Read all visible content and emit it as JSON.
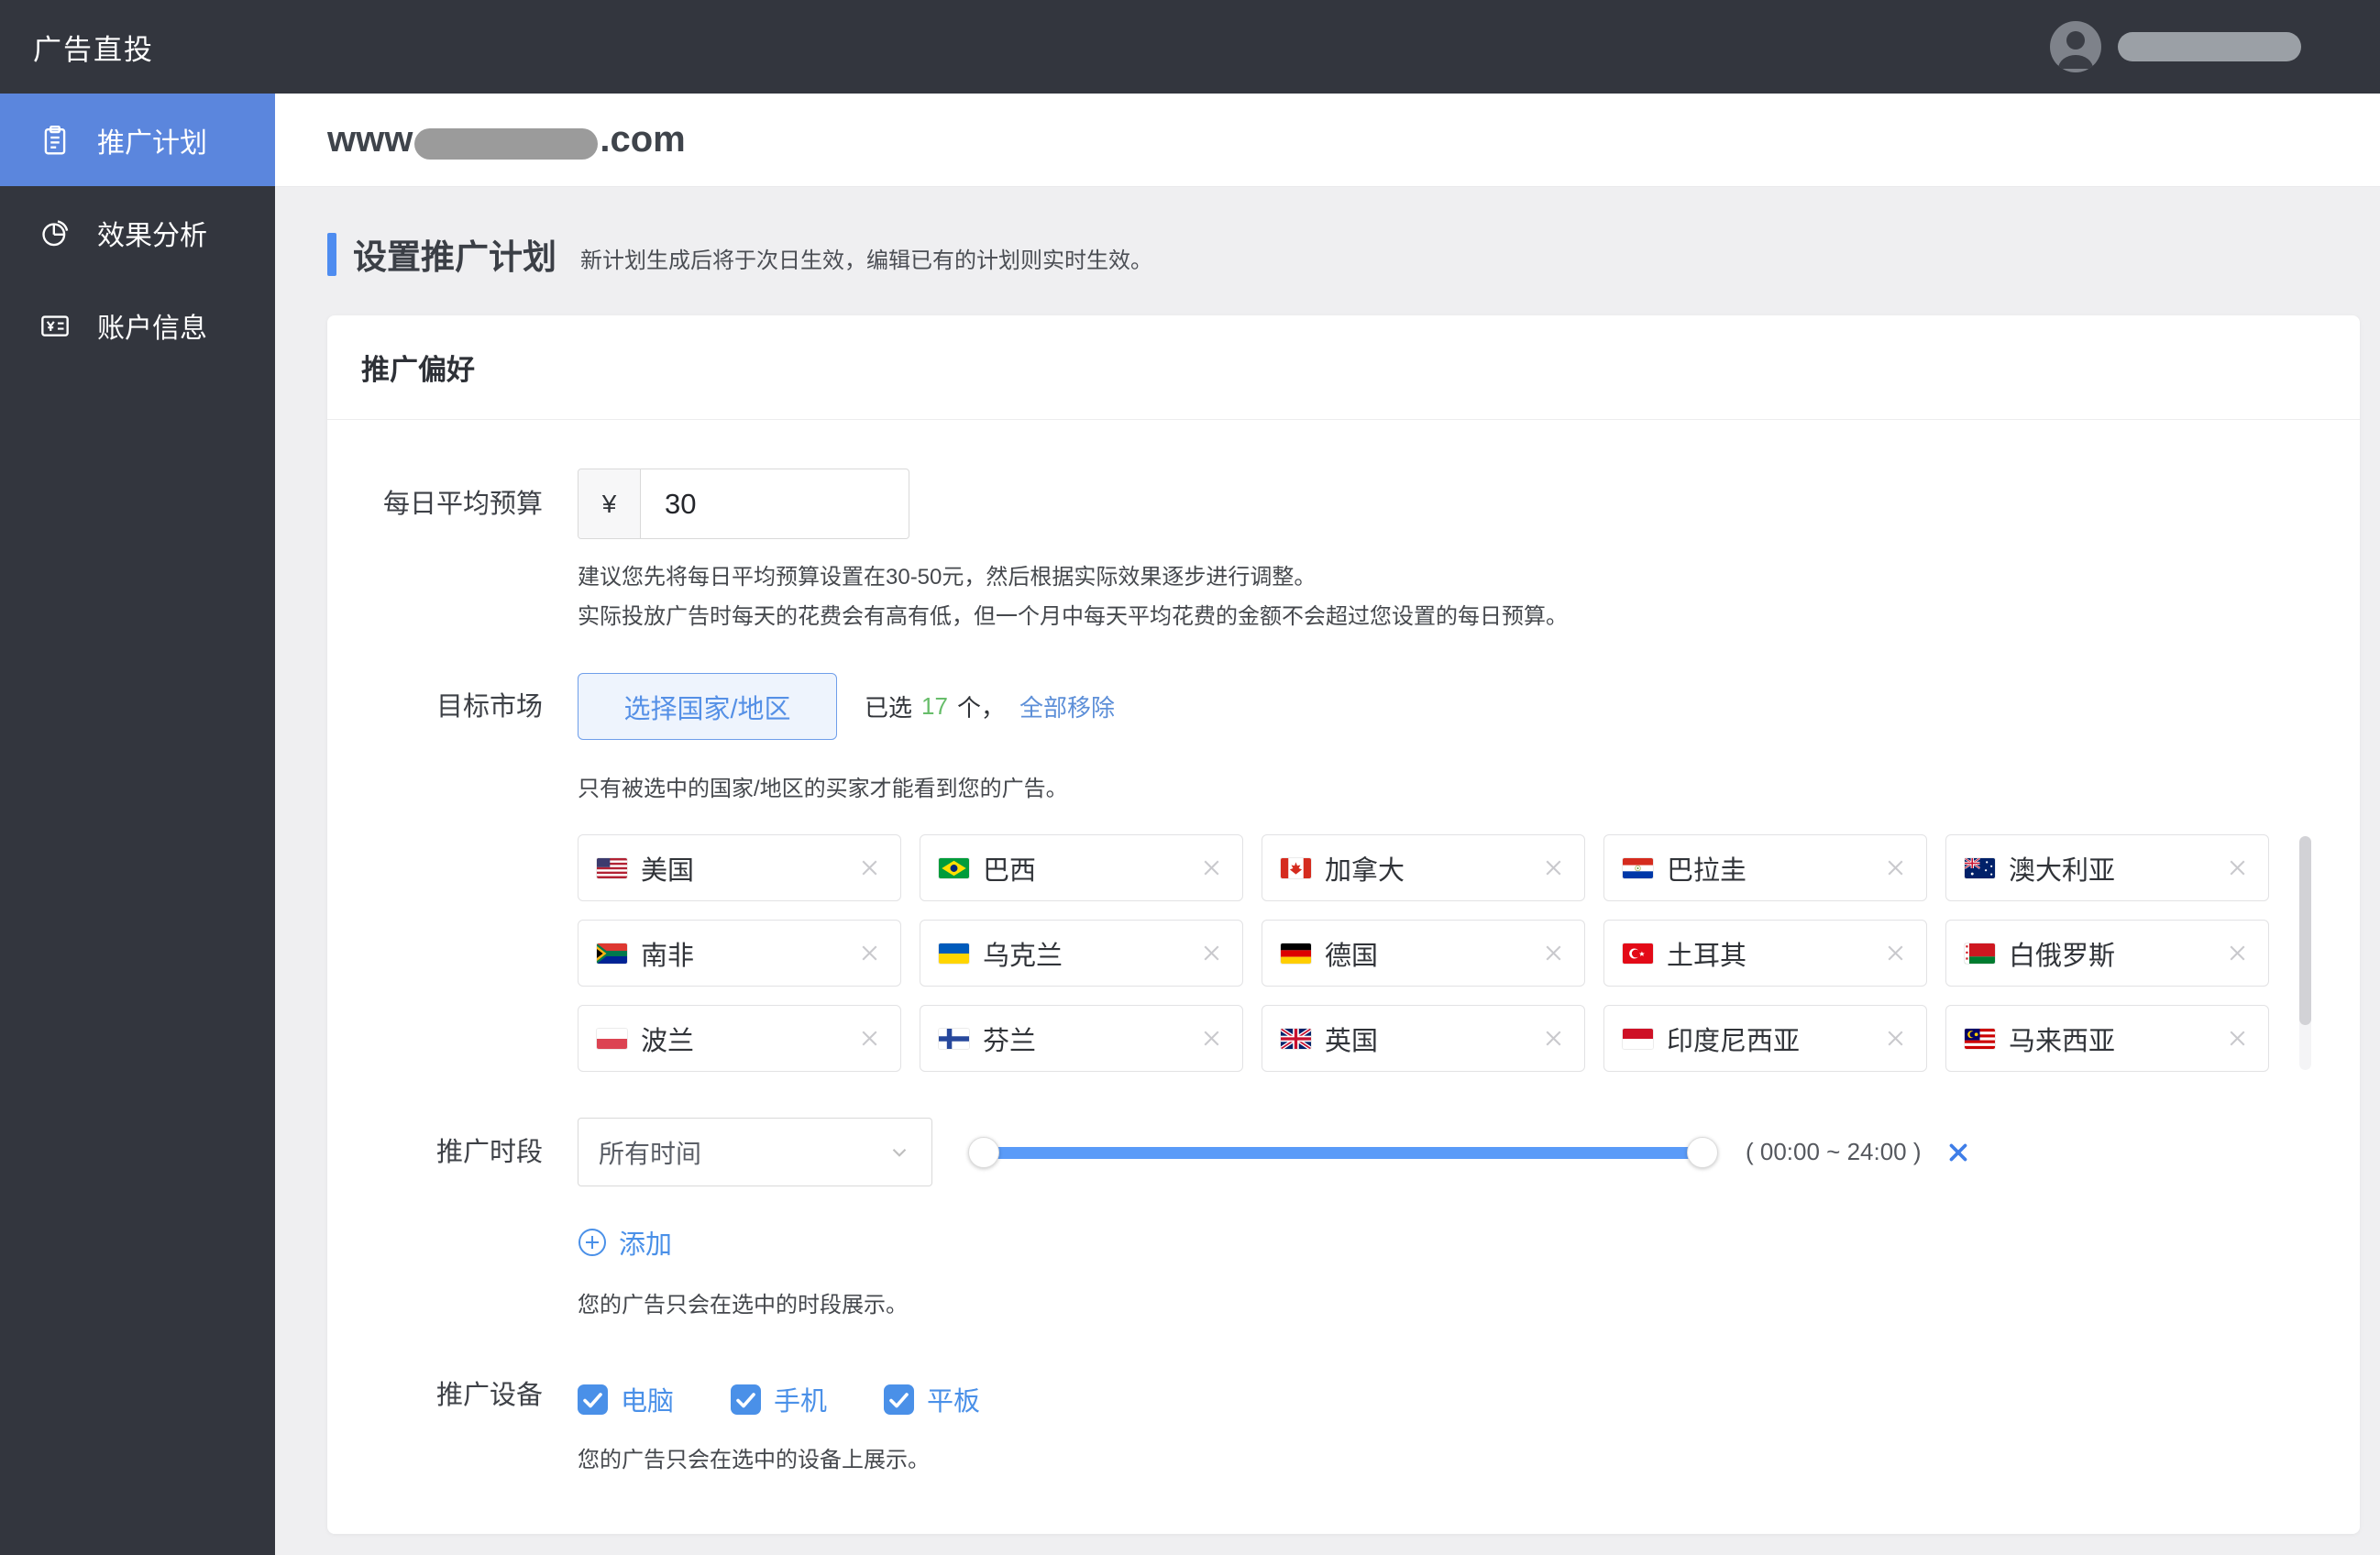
{
  "app": {
    "title": "广告直投"
  },
  "topbar": {
    "avatar_icon": "user-icon",
    "username_redacted": true
  },
  "sidebar": {
    "items": [
      {
        "id": "plans",
        "label": "推广计划",
        "icon": "clipboard-icon",
        "active": true
      },
      {
        "id": "analysis",
        "label": "效果分析",
        "icon": "pie-chart-icon",
        "active": false
      },
      {
        "id": "account",
        "label": "账户信息",
        "icon": "account-card-icon",
        "active": false
      }
    ]
  },
  "content_header": {
    "domain_prefix": "www",
    "domain_suffix": ".com",
    "domain_redacted": true
  },
  "page": {
    "title": "设置推广计划",
    "subtitle": "新计划生成后将于次日生效，编辑已有的计划则实时生效。",
    "card_title": "推广偏好"
  },
  "budget": {
    "label": "每日平均预算",
    "currency_symbol": "¥",
    "value": "30",
    "help_lines": [
      "建议您先将每日平均预算设置在30-50元，然后根据实际效果逐步进行调整。",
      "实际投放广告时每天的花费会有高有低，但一个月中每天平均花费的金额不会超过您设置的每日预算。"
    ]
  },
  "market": {
    "label": "目标市场",
    "select_button": "选择国家/地区",
    "selected_prefix": "已选",
    "selected_count": "17",
    "selected_suffix": "个，",
    "remove_all": "全部移除",
    "help": "只有被选中的国家/地区的买家才能看到您的广告。",
    "countries": [
      {
        "name": "美国",
        "flag": "us"
      },
      {
        "name": "巴西",
        "flag": "br"
      },
      {
        "name": "加拿大",
        "flag": "ca"
      },
      {
        "name": "巴拉圭",
        "flag": "py"
      },
      {
        "name": "澳大利亚",
        "flag": "au"
      },
      {
        "name": "南非",
        "flag": "za"
      },
      {
        "name": "乌克兰",
        "flag": "ua"
      },
      {
        "name": "德国",
        "flag": "de"
      },
      {
        "name": "土耳其",
        "flag": "tr"
      },
      {
        "name": "白俄罗斯",
        "flag": "by"
      },
      {
        "name": "波兰",
        "flag": "pl"
      },
      {
        "name": "芬兰",
        "flag": "fi"
      },
      {
        "name": "英国",
        "flag": "gb"
      },
      {
        "name": "印度尼西亚",
        "flag": "id"
      },
      {
        "name": "马来西亚",
        "flag": "my"
      }
    ]
  },
  "schedule": {
    "label": "推广时段",
    "select_value": "所有时间",
    "range_label": "( 00:00 ~ 24:00 )",
    "slider": {
      "start": "00:00",
      "end": "24:00",
      "start_pct": 0,
      "end_pct": 100
    },
    "add_label": "添加",
    "help": "您的广告只会在选中的时段展示。"
  },
  "devices": {
    "label": "推广设备",
    "options": [
      {
        "label": "电脑",
        "checked": true
      },
      {
        "label": "手机",
        "checked": true
      },
      {
        "label": "平板",
        "checked": true
      }
    ],
    "help": "您的广告只会在选中的设备上展示。"
  },
  "colors": {
    "topbar_bg": "#33363e",
    "sidebar_active": "#5b86dd",
    "accent_blue": "#4a90e8",
    "slider_blue": "#5a9bf8",
    "count_green": "#67bd6a",
    "page_bg": "#efeff1"
  }
}
